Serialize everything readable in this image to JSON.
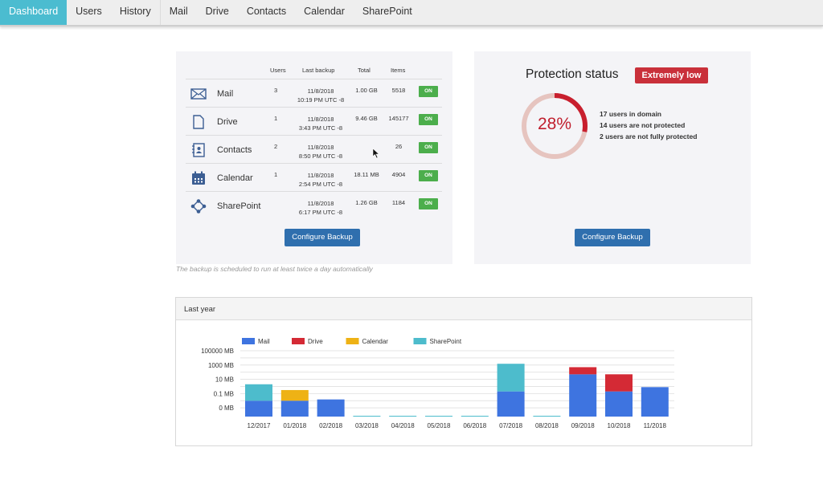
{
  "nav": {
    "items": [
      {
        "label": "Dashboard",
        "active": true
      },
      {
        "label": "Users"
      },
      {
        "label": "History"
      },
      {
        "label": "Mail"
      },
      {
        "label": "Drive"
      },
      {
        "label": "Contacts"
      },
      {
        "label": "Calendar"
      },
      {
        "label": "SharePoint"
      }
    ]
  },
  "backup": {
    "columns": {
      "users": "Users",
      "last_backup": "Last backup",
      "total": "Total",
      "items": "Items"
    },
    "rows": [
      {
        "name": "Mail",
        "icon": "mail-icon",
        "users": "3",
        "date": "11/8/2018",
        "time": "10:19 PM UTC -8",
        "total": "1.00 GB",
        "items": "5518",
        "status": "ON"
      },
      {
        "name": "Drive",
        "icon": "document-icon",
        "users": "1",
        "date": "11/8/2018",
        "time": "3:43 PM UTC -8",
        "total": "9.46 GB",
        "items": "145177",
        "status": "ON"
      },
      {
        "name": "Contacts",
        "icon": "address-book-icon",
        "users": "2",
        "date": "11/8/2018",
        "time": "8:50 PM UTC -8",
        "total": "",
        "items": "26",
        "status": "ON"
      },
      {
        "name": "Calendar",
        "icon": "calendar-icon",
        "users": "1",
        "date": "11/8/2018",
        "time": "2:54 PM UTC -8",
        "total": "18.11 MB",
        "items": "4904",
        "status": "ON"
      },
      {
        "name": "SharePoint",
        "icon": "sharepoint-icon",
        "users": "",
        "date": "11/8/2018",
        "time": "6:17 PM UTC -8",
        "total": "1.26 GB",
        "items": "1184",
        "status": "ON"
      }
    ],
    "configure_label": "Configure Backup",
    "note": "The backup is scheduled to run at least twice a day automatically"
  },
  "protection": {
    "title": "Protection status",
    "badge": "Extremely low",
    "percent_label": "28%",
    "percent": 28,
    "stats": [
      "17 users in domain",
      "14 users are not protected",
      "2 users are not fully protected"
    ],
    "configure_label": "Configure Backup",
    "colors": {
      "ring": "#c81f2e",
      "track": "#e6c4bf"
    }
  },
  "chart": {
    "header": "Last year"
  },
  "chart_data": {
    "type": "bar",
    "stacked": true,
    "title": "Last year",
    "xlabel": "",
    "ylabel": "",
    "yscale": "log",
    "ylim": [
      0.0001,
      100000
    ],
    "y_tick_labels": [
      "100000 MB",
      "1000 MB",
      "10 MB",
      "0.1 MB",
      "0 MB"
    ],
    "y_tick_values": [
      100000,
      1000,
      10,
      0.1,
      0.001
    ],
    "grid": true,
    "legend": "top-left",
    "categories": [
      "12/2017",
      "01/2018",
      "02/2018",
      "03/2018",
      "04/2018",
      "05/2018",
      "06/2018",
      "07/2018",
      "08/2018",
      "09/2018",
      "10/2018",
      "11/2018"
    ],
    "series": [
      {
        "name": "Mail",
        "color": "#3e74e0",
        "values": [
          0.01,
          0.01,
          0.015,
          0,
          0,
          0,
          0,
          0.2,
          0,
          50,
          0.2,
          0.8
        ]
      },
      {
        "name": "Drive",
        "color": "#d42a35",
        "values": [
          0,
          0,
          0,
          0,
          0,
          0,
          0,
          0,
          0,
          450,
          50,
          0
        ]
      },
      {
        "name": "Calendar",
        "color": "#eeb215",
        "values": [
          0,
          0.3,
          0,
          0,
          0,
          0,
          0,
          0,
          0,
          0,
          0,
          0
        ]
      },
      {
        "name": "SharePoint",
        "color": "#4dbccc",
        "values": [
          2,
          0,
          0,
          0,
          0,
          0,
          0,
          1500,
          0,
          0,
          0,
          0
        ]
      }
    ]
  }
}
